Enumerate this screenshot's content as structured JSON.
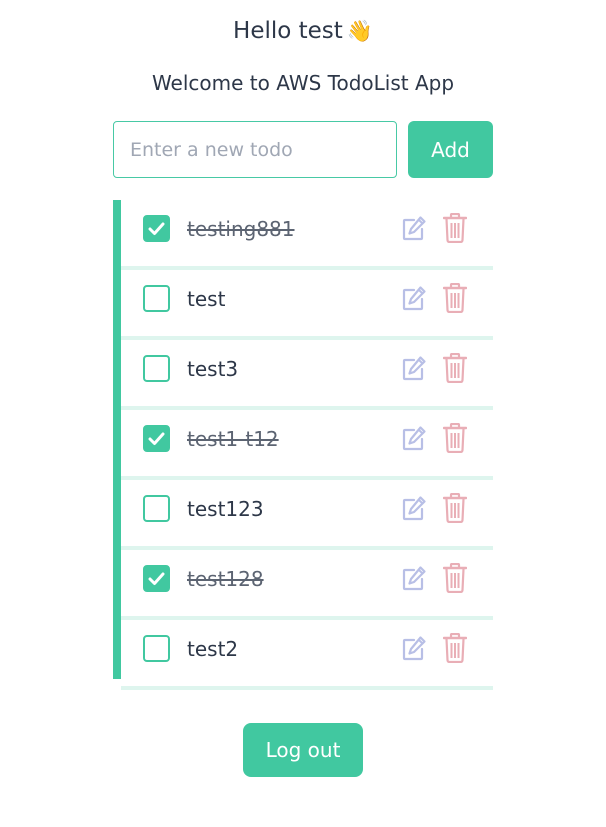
{
  "header": {
    "greeting": "Hello test",
    "wave_emoji": "👋",
    "subtitle": "Welcome to AWS TodoList App"
  },
  "new_todo": {
    "placeholder": "Enter a new todo",
    "value": "",
    "add_label": "Add"
  },
  "todos": [
    {
      "text": "testing881",
      "completed": true
    },
    {
      "text": "test",
      "completed": false
    },
    {
      "text": "test3",
      "completed": false
    },
    {
      "text": "test1-t12",
      "completed": true
    },
    {
      "text": "test123",
      "completed": false
    },
    {
      "text": "test128",
      "completed": true
    },
    {
      "text": "test2",
      "completed": false
    }
  ],
  "icons": {
    "check": "check-icon",
    "edit": "edit-icon",
    "delete": "trash-icon"
  },
  "footer": {
    "logout_label": "Log out"
  },
  "colors": {
    "accent": "#41c8a0",
    "edit_icon": "#b8bfe6",
    "delete_icon": "#e9aeb6",
    "divider": "#def5ee"
  }
}
